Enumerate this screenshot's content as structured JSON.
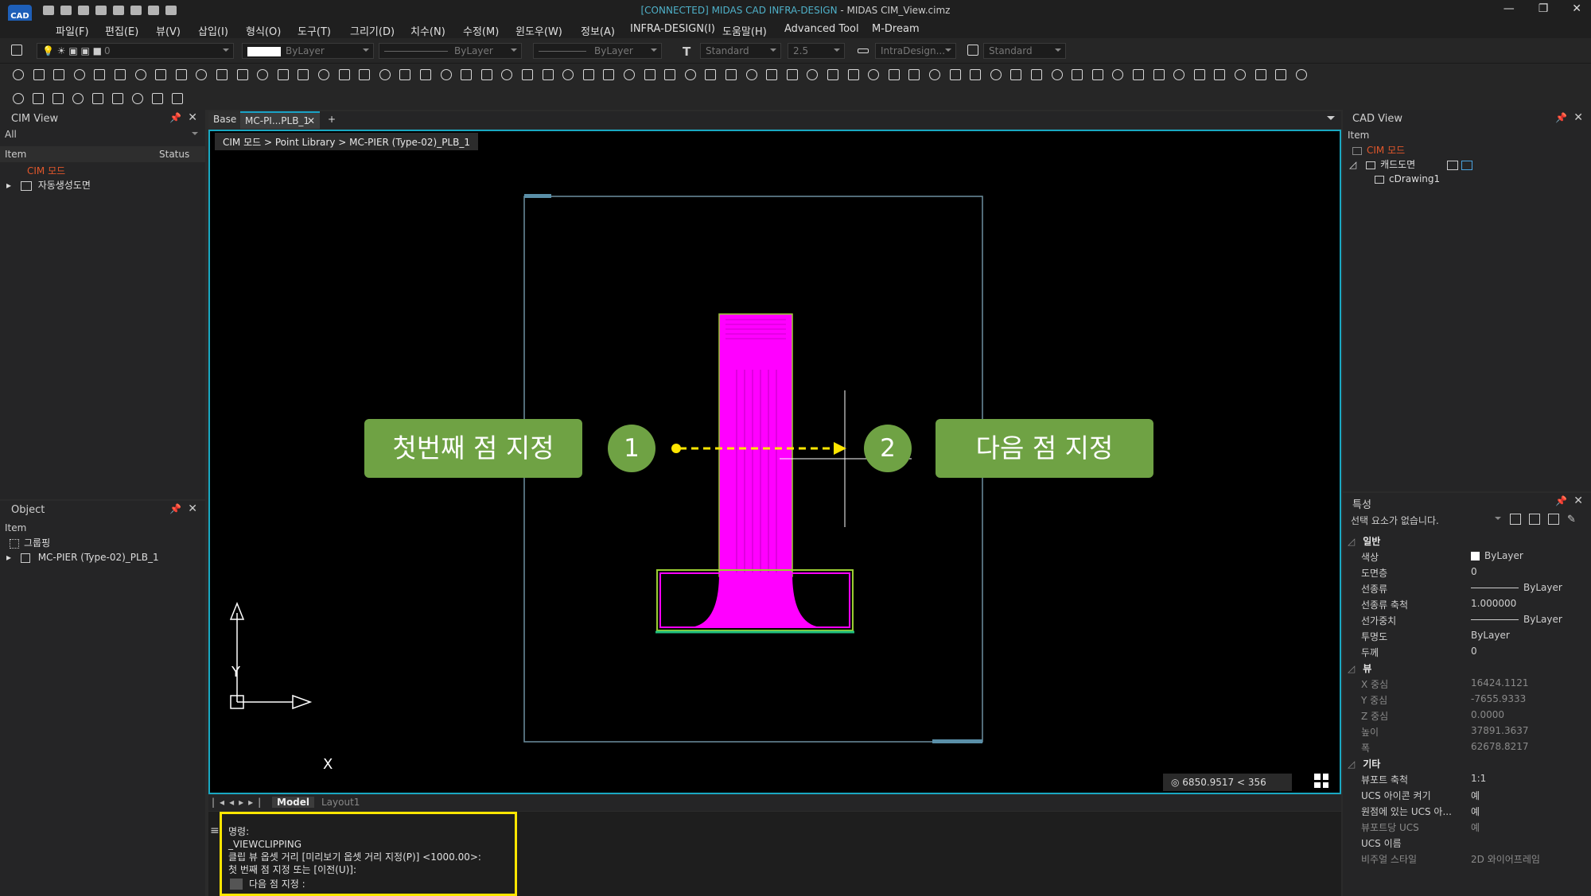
{
  "title": {
    "connected": "[CONNECTED] MIDAS CAD INFRA-DESIGN",
    "rest": " - MIDAS CIM_View.cimz",
    "logo": "CAD"
  },
  "window_buttons": [
    "—",
    "❐",
    "✕"
  ],
  "menu": [
    "파일(F)",
    "편집(E)",
    "뷰(V)",
    "삽입(I)",
    "형식(O)",
    "도구(T)",
    "그리기(D)",
    "치수(N)",
    "수정(M)",
    "윈도우(W)",
    "정보(A)",
    "INFRA-DESIGN(I)",
    "도움말(H)",
    "Advanced Tool",
    "M-Dream"
  ],
  "properties_bar": {
    "layer": "0",
    "color": "ByLayer",
    "linetype": "ByLayer",
    "lineweight": "ByLayer",
    "text_style": "Standard",
    "text_height": "2.5",
    "dim_style": "IntraDesign...",
    "table_style": "Standard"
  },
  "cim_view": {
    "title": "CIM View",
    "filter": "All",
    "col_item": "Item",
    "col_status": "Status",
    "rows": [
      "CIM 모드",
      "자동생성도면"
    ]
  },
  "object_panel": {
    "title": "Object",
    "col_item": "Item",
    "rows": [
      "그룹핑",
      "MC-PIER (Type-02)_PLB_1"
    ]
  },
  "tabs": [
    "Base",
    "MC-PI...PLB_1",
    "+"
  ],
  "breadcrumb": "CIM 모드 > Point Library > MC-PIER (Type-02)_PLB_1",
  "annotation": {
    "left_label": "첫번째 점 지정",
    "right_label": "다음 점 지정",
    "step1": "1",
    "step2": "2",
    "arrow_color": "#ffe600",
    "label_color": "#6fa244"
  },
  "axis": {
    "x": "X",
    "y": "Y"
  },
  "coord_readout": "6850.9517 < 356",
  "layout_tabs": [
    "Model",
    "Layout1"
  ],
  "command_lines": [
    "명령:",
    "_VIEWCLIPPING",
    "클립 뷰 옵셋 거리 [미리보기 옵셋 거리 지정(P)] <1000.00>:",
    "첫 번째 점 지정 또는 [이전(U)]:"
  ],
  "command_prompt": "다음 점 지정 :",
  "cad_view": {
    "title": "CAD View",
    "col_item": "Item",
    "rows": [
      "CIM 모드",
      "캐드도면",
      "cDrawing1"
    ]
  },
  "properties": {
    "title": "특성",
    "selection": "선택 요소가 없습니다.",
    "sections": [
      {
        "name": "일반",
        "items": [
          {
            "label": "색상",
            "value": "ByLayer"
          },
          {
            "label": "도면층",
            "value": "0"
          },
          {
            "label": "선종류",
            "value": "ByLayer"
          },
          {
            "label": "선종류 축척",
            "value": "1.000000"
          },
          {
            "label": "선가중치",
            "value": "ByLayer"
          },
          {
            "label": "투명도",
            "value": "ByLayer"
          },
          {
            "label": "두께",
            "value": "0"
          }
        ]
      },
      {
        "name": "뷰",
        "items": [
          {
            "label": "X 중심",
            "value": "16424.1121"
          },
          {
            "label": "Y 중심",
            "value": "-7655.9333"
          },
          {
            "label": "Z 중심",
            "value": "0.0000"
          },
          {
            "label": "높이",
            "value": "37891.3637"
          },
          {
            "label": "폭",
            "value": "62678.8217"
          }
        ]
      },
      {
        "name": "기타",
        "items": [
          {
            "label": "뷰포트 축척",
            "value": "1:1"
          },
          {
            "label": "UCS 아이콘 켜기",
            "value": "예"
          },
          {
            "label": "원점에 있는 UCS 아...",
            "value": "예"
          },
          {
            "label": "뷰포트당 UCS",
            "value": "예"
          },
          {
            "label": "UCS 이름",
            "value": ""
          },
          {
            "label": "비주얼 스타일",
            "value": "2D 와이어프레임"
          }
        ]
      }
    ]
  }
}
